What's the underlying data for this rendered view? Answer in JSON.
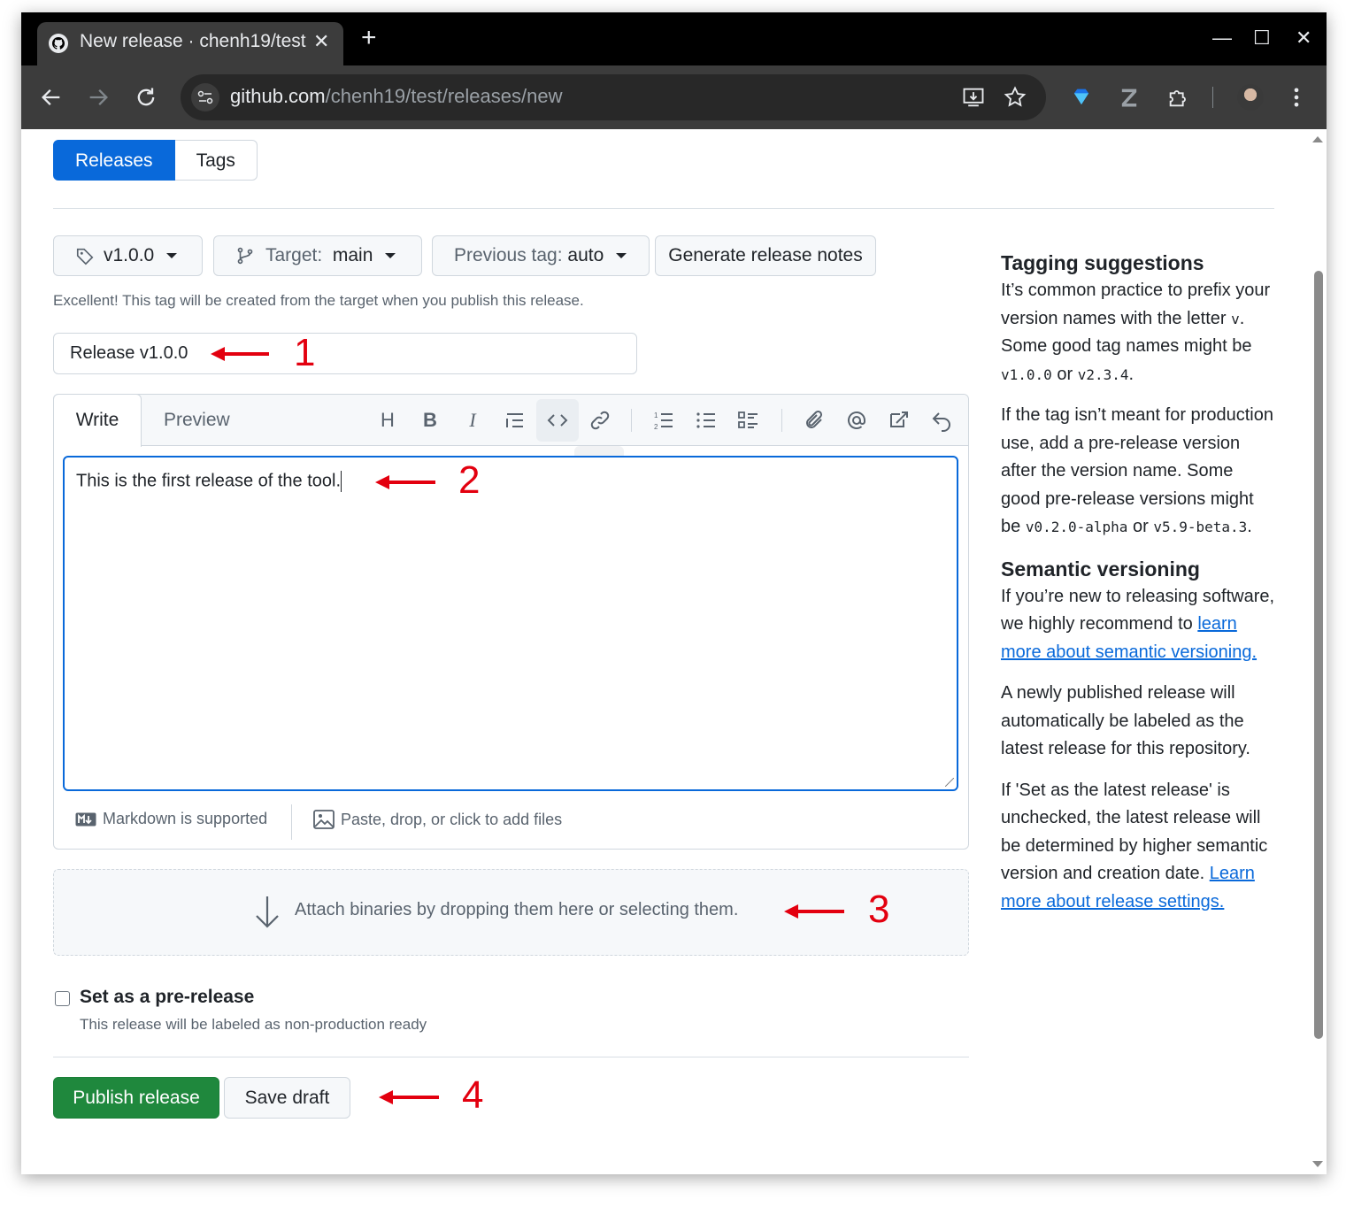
{
  "browser": {
    "tab_title": "New release · chenh19/test",
    "url_host": "github.com",
    "url_path": "/chenh19/test/releases/new"
  },
  "subnav": {
    "releases": "Releases",
    "tags": "Tags"
  },
  "controls": {
    "tag": "v1.0.0",
    "target_label": "Target:",
    "target_value": "main",
    "previous_tag_label": "Previous tag:",
    "previous_tag_value": "auto",
    "generate_notes": "Generate release notes"
  },
  "hint": "Excellent! This tag will be created from the target when you publish this release.",
  "release_title": "Release v1.0.0",
  "editor": {
    "write_tab": "Write",
    "preview_tab": "Preview",
    "body": "This is the first release of the tool.",
    "tooltip": "Link",
    "markdown_note": "Markdown is supported",
    "attach_note": "Paste, drop, or click to add files"
  },
  "dropzone": "Attach binaries by dropping them here or selecting them.",
  "prerelease": {
    "label": "Set as a pre-release",
    "description": "This release will be labeled as non-production ready"
  },
  "actions": {
    "publish": "Publish release",
    "save_draft": "Save draft"
  },
  "annotations": [
    "1",
    "2",
    "3",
    "4"
  ],
  "sidebar": {
    "tagging_title": "Tagging suggestions",
    "tagging_p1_a": "It’s common practice to prefix your version names with the letter ",
    "tagging_p1_code1": "v",
    "tagging_p1_b": ". Some good tag names might be ",
    "tagging_p1_code2": "v1.0.0",
    "tagging_p1_c": " or ",
    "tagging_p1_code3": "v2.3.4",
    "tagging_p1_d": ".",
    "tagging_p2_a": "If the tag isn’t meant for production use, add a pre-release version after the version name. Some good pre-release versions might be ",
    "tagging_p2_code1": "v0.2.0-alpha",
    "tagging_p2_b": " or ",
    "tagging_p2_code2": "v5.9-beta.3",
    "tagging_p2_c": ".",
    "semver_title": "Semantic versioning",
    "semver_p1": "If you’re new to releasing software, we highly recommend to ",
    "semver_link": "learn more about semantic versioning.",
    "semver_p2": "A newly published release will automatically be labeled as the latest release for this repository.",
    "semver_p3": "If 'Set as the latest release' is unchecked, the latest release will be determined by higher semantic version and creation date. ",
    "semver_link2": "Learn more about release settings."
  },
  "colors": {
    "accent": "#0969da",
    "primary_button": "#1f883d",
    "annotation": "#e3000f"
  }
}
